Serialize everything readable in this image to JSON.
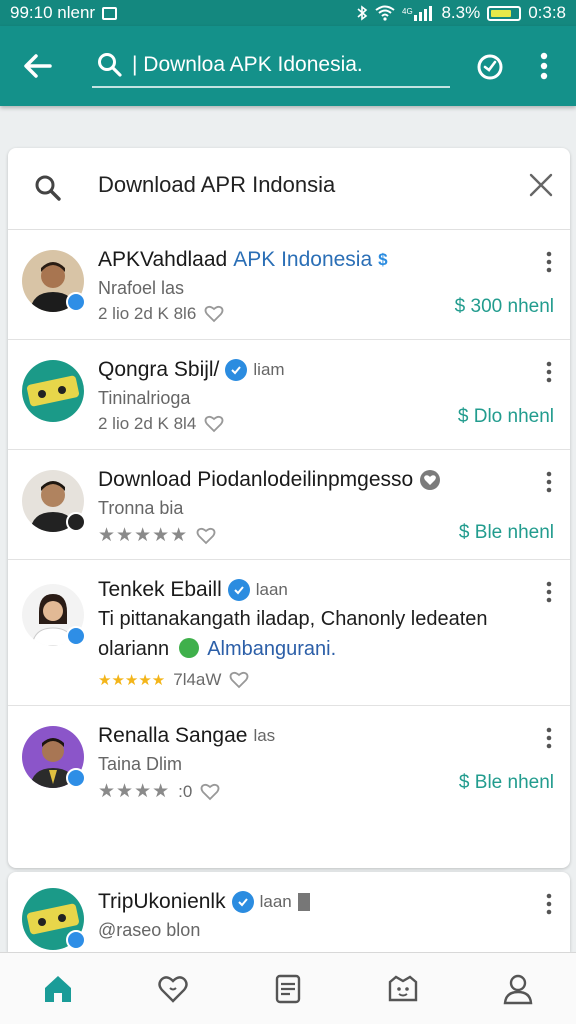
{
  "status_bar": {
    "time": "99:10 nlenr",
    "battery": "8.3%",
    "clock_right": "0:3:8"
  },
  "app_bar": {
    "search_value": "| Downloa APK Idonesia.",
    "icons": [
      "back-arrow-icon",
      "search-icon",
      "timer-icon",
      "more-vert-icon"
    ]
  },
  "query": {
    "text": "Download APR Indonsia",
    "icons": [
      "search-icon",
      "close-icon"
    ]
  },
  "results": [
    {
      "name": "APKVahdlaad",
      "name_highlight": "APK Indonesia",
      "tag": "$",
      "subtitle": "Nrafoel las",
      "meta": "2 lio 2d K 8l6",
      "price": "$ 300 nhenl"
    },
    {
      "name": "Qongra Sbijl/",
      "tag": "liam",
      "subtitle": "Tininalrioga",
      "meta": "2 lio 2d K 8l4",
      "price": "$ Dlo nhenl"
    },
    {
      "name": "Download Piodanlodeilinpmgesso",
      "subtitle": "Tronna bia",
      "stars": "★★★★★",
      "price": "$ Ble nhenl"
    },
    {
      "name": "Tenkek Ebaill",
      "tag": "laan",
      "description": "Ti pittanakangath iladap, Chanonly ledeaten",
      "description2_start": "olariann",
      "description2_link": "Almbangurani.",
      "stars": "★★★★★",
      "meta": "7l4aW"
    },
    {
      "name": "Renalla Sangae",
      "tag": "las",
      "subtitle": "Taina Dlim",
      "stars": "★★★★",
      "meta": ":0",
      "price": "$ Ble nhenl"
    },
    {
      "name": "TripUkonienlk",
      "tag": "laan",
      "subtitle": "@raseo blon"
    }
  ],
  "colors": {
    "teal_bar": "#14918a",
    "price_green": "#229c8e",
    "link_blue": "#2c5fa8",
    "verified_blue": "#2b8ce0"
  },
  "bottom_nav": [
    "home-icon",
    "heart-icon",
    "list-icon",
    "kid-icon",
    "profile-icon"
  ]
}
